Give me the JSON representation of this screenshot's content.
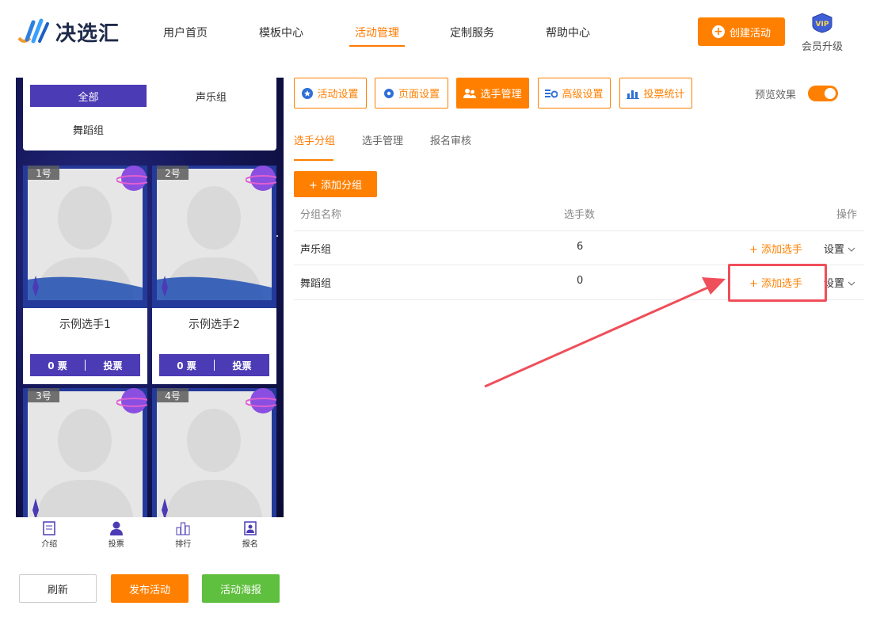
{
  "header": {
    "logo_text": "决选汇",
    "nav": [
      "用户首页",
      "模板中心",
      "活动管理",
      "定制服务",
      "帮助中心"
    ],
    "create_button": "创建活动",
    "vip_badge": "VIP",
    "vip_label": "会员升级"
  },
  "preview": {
    "groups": [
      "全部",
      "声乐组",
      "舞蹈组"
    ],
    "candidates": [
      {
        "number": "1号",
        "name": "示例选手1",
        "votes": "0 票",
        "vote_label": "投票"
      },
      {
        "number": "2号",
        "name": "示例选手2",
        "votes": "0 票",
        "vote_label": "投票"
      },
      {
        "number": "3号"
      },
      {
        "number": "4号"
      }
    ],
    "bottom_nav": [
      "介绍",
      "投票",
      "排行",
      "报名"
    ]
  },
  "actions": {
    "refresh": "刷新",
    "publish": "发布活动",
    "poster": "活动海报"
  },
  "toolbar": {
    "buttons": [
      "活动设置",
      "页面设置",
      "选手管理",
      "高级设置",
      "投票统计"
    ],
    "active": "选手管理",
    "preview_label": "预览效果",
    "preview_enabled": true
  },
  "subtabs": [
    "选手分组",
    "选手管理",
    "报名审核"
  ],
  "add_group_button": "+ 添加分组",
  "table": {
    "headers": [
      "分组名称",
      "选手数",
      "操作"
    ],
    "rows": [
      {
        "name": "声乐组",
        "count": "6",
        "add": "+ 添加选手",
        "settings": "设置"
      },
      {
        "name": "舞蹈组",
        "count": "0",
        "add": "+ 添加选手",
        "settings": "设置"
      }
    ]
  },
  "colors": {
    "accent": "#ff8000",
    "purple": "#4b3bb5",
    "green": "#5fbf3e",
    "annotation": "#ef4f5a"
  }
}
